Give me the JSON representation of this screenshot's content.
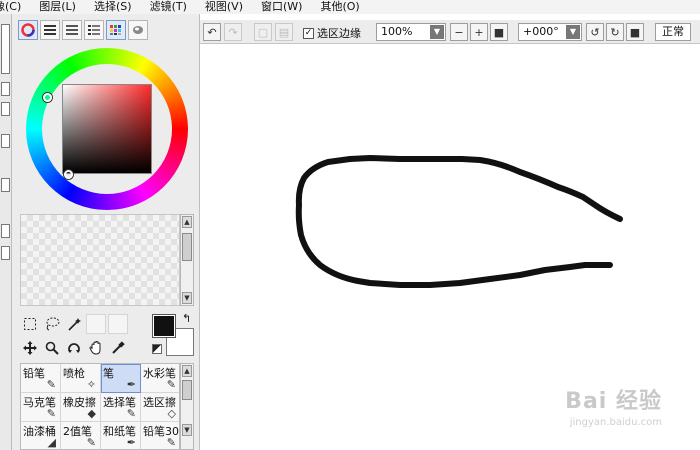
{
  "menu": [
    {
      "label": "像",
      "key": "(C)"
    },
    {
      "label": "图层",
      "key": "(L)"
    },
    {
      "label": "选择",
      "key": "(S)"
    },
    {
      "label": "滤镜",
      "key": "(T)"
    },
    {
      "label": "视图",
      "key": "(V)"
    },
    {
      "label": "窗口",
      "key": "(W)"
    },
    {
      "label": "其他",
      "key": "(O)"
    }
  ],
  "toolbar": {
    "selection_edge_label": "选区边缘",
    "selection_edge_checked": true,
    "zoom_value": "100%",
    "rotation_value": "+000°",
    "blend_mode": "正常"
  },
  "colors": {
    "foreground": "#111111",
    "background": "#ffffff",
    "stroke": "#111111"
  },
  "tools": [
    {
      "name": "rect-select",
      "icon": "rectangle-select-icon"
    },
    {
      "name": "lasso",
      "icon": "lasso-icon"
    },
    {
      "name": "magic-wand",
      "icon": "magic-wand-icon"
    },
    {
      "name": "move",
      "icon": "move-icon"
    },
    {
      "name": "zoom",
      "icon": "zoom-icon"
    },
    {
      "name": "rotate",
      "icon": "rotate-icon"
    },
    {
      "name": "hand",
      "icon": "hand-icon"
    },
    {
      "name": "eyedropper",
      "icon": "eyedropper-icon"
    }
  ],
  "brushes": [
    {
      "label": "铅笔",
      "active": false
    },
    {
      "label": "喷枪",
      "active": false
    },
    {
      "label": "笔",
      "active": true
    },
    {
      "label": "水彩笔",
      "active": false
    },
    {
      "label": "马克笔",
      "active": false
    },
    {
      "label": "橡皮擦",
      "active": false
    },
    {
      "label": "选择笔",
      "active": false
    },
    {
      "label": "选区擦",
      "active": false
    },
    {
      "label": "油漆桶",
      "active": false
    },
    {
      "label": "2值笔",
      "active": false
    },
    {
      "label": "和纸笔",
      "active": false
    },
    {
      "label": "铅笔30",
      "active": false
    }
  ],
  "watermark": {
    "main": "Bai 经验",
    "sub": "jingyan.baidu.com"
  }
}
